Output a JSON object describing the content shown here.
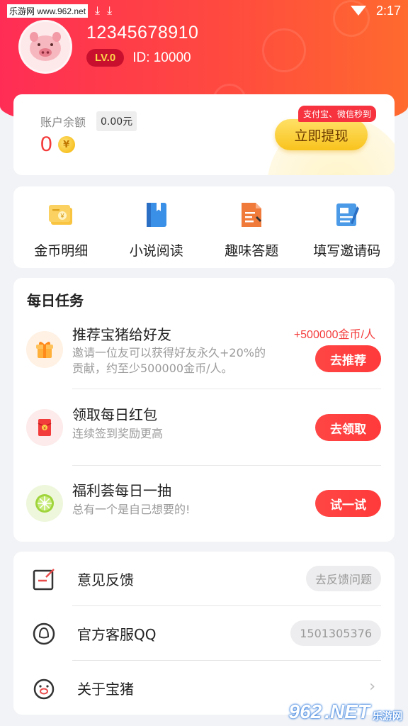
{
  "status_bar": {
    "watermark": "乐游网 www.962.net",
    "time": "2:17"
  },
  "profile": {
    "phone": "12345678910",
    "level": "LV.0",
    "id_text": "ID: 10000"
  },
  "balance": {
    "label": "账户余额",
    "coins": "0",
    "rmb": "0.00元",
    "withdraw_tip": "支付宝、微信秒到",
    "withdraw_label": "立即提现"
  },
  "menu": [
    {
      "label": "金币明细",
      "icon": "coin-detail-icon"
    },
    {
      "label": "小说阅读",
      "icon": "book-icon"
    },
    {
      "label": "趣味答题",
      "icon": "quiz-icon"
    },
    {
      "label": "填写邀请码",
      "icon": "invite-code-icon"
    }
  ],
  "tasks": {
    "title": "每日任务",
    "items": [
      {
        "title": "推荐宝猪给好友",
        "reward": "+500000金币/人",
        "desc_line1": "邀请一位友可以获得好友永久+20%的",
        "desc_line2": "贡献，约至少500000金币/人。",
        "button": "去推荐",
        "icon": "gift-icon"
      },
      {
        "title": "领取每日红包",
        "desc_line1": "连续签到奖励更高",
        "button": "去领取",
        "icon": "red-envelope-icon"
      },
      {
        "title": "福利荟每日一抽",
        "desc_line1": "总有一个是自己想要的!",
        "button": "试一试",
        "icon": "lucky-wheel-icon"
      }
    ]
  },
  "settings": [
    {
      "label": "意见反馈",
      "pill": "去反馈问题",
      "icon": "feedback-icon"
    },
    {
      "label": "官方客服QQ",
      "pill": "1501305376",
      "icon": "qq-icon"
    },
    {
      "label": "关于宝猪",
      "icon": "pig-icon"
    }
  ],
  "site_watermark": {
    "brand": "962",
    "suffix": ".NET",
    "sub": "乐游网"
  },
  "colors": {
    "header_red": "#ff2d55",
    "accent_red": "#f43b3b",
    "gold": "#f8c31d"
  }
}
